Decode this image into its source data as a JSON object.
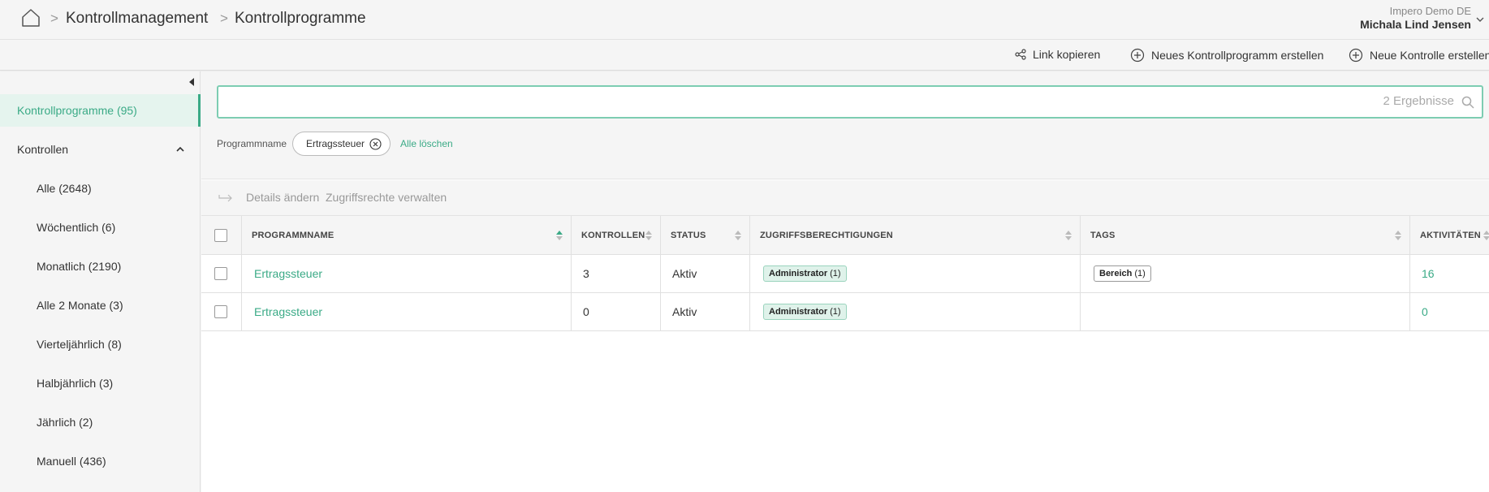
{
  "breadcrumb": {
    "items": [
      "Kontrollmanagement",
      "Kontrollprogramme"
    ],
    "separator": ">"
  },
  "account": {
    "organization": "Impero Demo DE",
    "user": "Michala Lind Jensen"
  },
  "actions": {
    "copy_link": "Link kopieren",
    "new_program": "Neues Kontrollprogramm erstellen",
    "new_control": "Neue Kontrolle erstellen"
  },
  "sidebar": {
    "programs": "Kontrollprogramme (95)",
    "controls": "Kontrollen",
    "items": [
      "Alle (2648)",
      "Wöchentlich (6)",
      "Monatlich (2190)",
      "Alle 2 Monate (3)",
      "Vierteljährlich (8)",
      "Halbjährlich (3)",
      "Jährlich (2)",
      "Manuell (436)"
    ]
  },
  "search": {
    "value": "",
    "result_count": "2 Ergebnisse"
  },
  "filters": {
    "label": "Programmname",
    "chip": "Ertragssteuer",
    "clear_all": "Alle löschen"
  },
  "toolbar": {
    "edit_details": "Details ändern",
    "manage_access": "Zugriffsrechte verwalten"
  },
  "table": {
    "columns": {
      "name": "PROGRAMMNAME",
      "controls": "KONTROLLEN",
      "status": "STATUS",
      "access": "ZUGRIFFSBERECHTIGUNGEN",
      "tags": "TAGS",
      "activities": "AKTIVITÄTEN"
    },
    "rows": [
      {
        "name": "Ertragssteuer",
        "controls": "3",
        "status": "Aktiv",
        "access_label": "Administrator",
        "access_count": "(1)",
        "tag_label": "Bereich",
        "tag_count": "(1)",
        "activities": "16"
      },
      {
        "name": "Ertragssteuer",
        "controls": "0",
        "status": "Aktiv",
        "access_label": "Administrator",
        "access_count": "(1)",
        "activities": "0"
      }
    ]
  },
  "colors": {
    "accent": "#3aaa86",
    "accent_light": "#e5f4ee",
    "background": "#f5f5f5"
  }
}
